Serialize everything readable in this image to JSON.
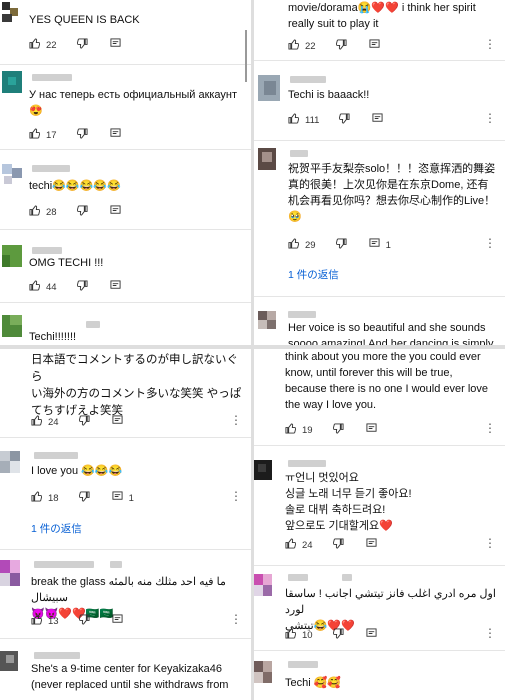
{
  "panels": {
    "top_left": [
      {
        "text": "YES QUEEN IS BACK",
        "likes": "22"
      },
      {
        "text": "У нас теперь есть официальный аккаунт\n😍",
        "likes": "17"
      },
      {
        "text": "techi😂😂😂😂😂",
        "likes": "28"
      },
      {
        "text": "OMG TECHI !!!",
        "likes": "44"
      },
      {
        "text": "Techi!!!!!!!"
      }
    ],
    "top_right": [
      {
        "text": "movie/dorama😭❤️❤️ i think her spirit\nreally suit to play it",
        "likes": "22"
      },
      {
        "text": "Techi is baaack!!",
        "likes": "111"
      },
      {
        "text": "祝贺平手友梨奈solo！！！恣意挥洒的舞姿\n真的很美！上次见你是在东京Dome, 还有\n机会再看见你吗？想去你尽心制作的Live！\n🥹",
        "likes": "29",
        "reply_count": "1",
        "replies": "1 件の返信"
      },
      {
        "text": "Her voice is so beautiful and she sounds\nsoooo amazing! And her dancing is simply"
      }
    ],
    "bottom_left": [
      {
        "text": "日本語でコメントするのが申し訳ないぐら\nい海外の方のコメント多いな笑笑 やっぱ\nてちすげえよ笑笑",
        "likes": "24"
      },
      {
        "text": "I love you 😂😂😂",
        "likes": "18",
        "reply_count": "1",
        "replies": "1 件の返信"
      },
      {
        "text": "break the glass ما فيه احد مثلك منه بالمئه سبيشال\n😈😈❤️❤️🇸🇦🇸🇦",
        "likes": "13"
      },
      {
        "text": "She's a 9-time center for Keyakizaka46\n(never replaced until she withdraws from"
      }
    ],
    "bottom_right": [
      {
        "text": "think about you more the you could ever\nknow, until forever this will be true,\nbecause there is no one I would ever love\nthe way I love you.",
        "likes": "19"
      },
      {
        "text": "ㅠ언니 멋있어요\n싱글 노래 너무 듣기 좋아요!\n솔로 대뷔 축하드려요!\n앞으로도 기대할게요❤️",
        "likes": "24"
      },
      {
        "text": "اول مره ادري اغلب فانز تيتشي اجانب ! ساسقا لورد\nتيتشي😂❤️❤️",
        "likes": "10"
      },
      {
        "text": "Techi 🥰🥰"
      }
    ]
  },
  "icons": {
    "like": "thumb-up-icon",
    "dislike": "thumb-down-icon",
    "reply": "reply-icon",
    "more": "more-vert-icon"
  },
  "colors": {
    "link": "#065fd4",
    "divider": "#dedede"
  }
}
